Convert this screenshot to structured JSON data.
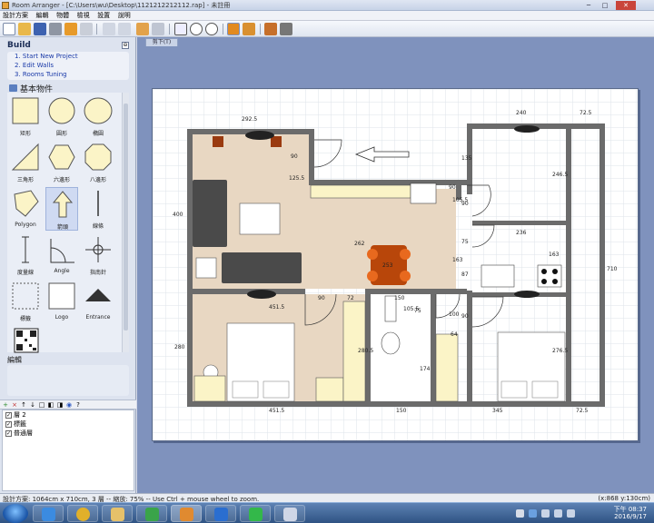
{
  "window": {
    "title": "Room Arranger - [C:\\Users\\wu\\Desktop\\1121212212112.rap] - 未註冊",
    "minimize": "─",
    "maximize": "□",
    "close": "✕"
  },
  "menu": [
    "設計方案",
    "編輯",
    "物體",
    "檢視",
    "設置",
    "說明"
  ],
  "toolbar_icons": [
    "new-icon",
    "open-icon",
    "save-icon",
    "print-icon",
    "magic-icon",
    "tape-icon",
    "undo-icon",
    "redo-icon",
    "car-icon",
    "eraser-icon",
    "zoom-fit-icon",
    "zoom-in-icon",
    "zoom-out-icon",
    "floor-2d-icon",
    "layers-3d-icon",
    "house-3d-icon",
    "cursor-icon"
  ],
  "sidebar": {
    "title": "Build",
    "collapse": "⊖",
    "links": [
      "1. Start New Project",
      "2. Edit Walls",
      "3. Rooms Tuning"
    ],
    "library_title": "基本物件",
    "items": [
      {
        "label": "矩形",
        "shape": "square"
      },
      {
        "label": "圓形",
        "shape": "circle"
      },
      {
        "label": "橢圓",
        "shape": "ellipse"
      },
      {
        "label": "三角形",
        "shape": "triangle"
      },
      {
        "label": "六邊形",
        "shape": "hexagon"
      },
      {
        "label": "八邊形",
        "shape": "octagon"
      },
      {
        "label": "Polygon",
        "shape": "polygon"
      },
      {
        "label": "箭頭",
        "shape": "arrow"
      },
      {
        "label": "線條",
        "shape": "line"
      },
      {
        "label": "度量線",
        "shape": "dimension"
      },
      {
        "label": "Angle",
        "shape": "angle"
      },
      {
        "label": "指南針",
        "shape": "compass"
      },
      {
        "label": "標籤",
        "shape": "label-box"
      },
      {
        "label": "Logo",
        "shape": "logo"
      },
      {
        "label": "Entrance",
        "shape": "entrance"
      },
      {
        "label": "",
        "shape": "qr"
      }
    ],
    "edit_title": "編輯"
  },
  "layers": {
    "toolbar": [
      "+",
      "×",
      "↑",
      "↓",
      "□",
      "◧",
      "◨",
      "◉",
      "?"
    ],
    "rows": [
      "層 2",
      "標籤",
      "普通層"
    ]
  },
  "tab_label": "剪下(T)",
  "plan": {
    "dimensions": [
      "292.5",
      "240",
      "72.5",
      "400",
      "125.5",
      "90",
      "135",
      "246.5",
      "710",
      "90",
      "105.5",
      "90",
      "236",
      "163",
      "262",
      "253",
      "75",
      "163",
      "87",
      "451.5",
      "90",
      "72",
      "150",
      "105.5",
      "75",
      "100",
      "90",
      "64",
      "280",
      "280.5",
      "174",
      "276.5",
      "451.5",
      "150",
      "345",
      "72.5"
    ]
  },
  "status": {
    "left": "設計方案: 1064cm x 710cm, 3 層 -- 縮放: 75% -- Use Ctrl + mouse wheel to zoom.",
    "right": "(x:868 y:130cm)"
  },
  "taskbar": {
    "apps": [
      "ie-icon",
      "chrome-icon",
      "explorer-icon",
      "recycle-icon",
      "roomarranger-icon",
      "ie2-icon",
      "line-icon",
      "house-icon"
    ],
    "time": "下午 08:37",
    "date": "2016/9/17"
  },
  "colors": {
    "wall": "#6b6b6b",
    "floor_wood": "#e8d7c2",
    "floor_tile": "#ffffff",
    "sofa": "#4a4a4a",
    "table_wood": "#b8460a",
    "chair_orange": "#e8691e",
    "cabinet_yellow": "#fbf4c7",
    "workspace": "#7f92bd"
  }
}
